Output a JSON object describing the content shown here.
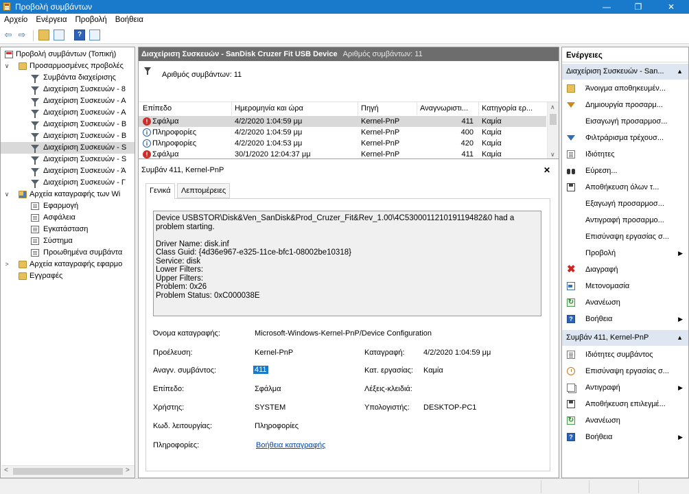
{
  "window": {
    "title": "Προβολή συμβάντων",
    "minimize": "—",
    "maximize": "❐",
    "close": "✕"
  },
  "menu": [
    "Αρχείο",
    "Ενέργεια",
    "Προβολή",
    "Βοήθεια"
  ],
  "toolbar": {
    "back": "⇦",
    "forward": "⇨",
    "help_glyph": "?"
  },
  "tree": {
    "items": [
      {
        "label": "Προβολή συμβάντων (Τοπική)",
        "icon": "event-viewer-icon",
        "level": 0,
        "twisty": ""
      },
      {
        "label": "Προσαρμοσμένες προβολές",
        "icon": "folder-icon",
        "level": 0,
        "twisty": "∨"
      },
      {
        "label": "Συμβάντα διαχείρισης",
        "icon": "filter-icon",
        "level": 1,
        "twisty": ""
      },
      {
        "label": "Διαχείριση Συσκευών - 8",
        "icon": "filter-icon",
        "level": 1,
        "twisty": ""
      },
      {
        "label": "Διαχείριση Συσκευών - Α",
        "icon": "filter-icon",
        "level": 1,
        "twisty": ""
      },
      {
        "label": "Διαχείριση Συσκευών - Α",
        "icon": "filter-icon",
        "level": 1,
        "twisty": ""
      },
      {
        "label": "Διαχείριση Συσκευών - Β",
        "icon": "filter-icon",
        "level": 1,
        "twisty": ""
      },
      {
        "label": "Διαχείριση Συσκευών - Β",
        "icon": "filter-icon",
        "level": 1,
        "twisty": ""
      },
      {
        "label": "Διαχείριση Συσκευών - S",
        "icon": "filter-icon",
        "level": 1,
        "twisty": "",
        "selected": true
      },
      {
        "label": "Διαχείριση Συσκευών - S",
        "icon": "filter-icon",
        "level": 1,
        "twisty": ""
      },
      {
        "label": "Διαχείριση Συσκευών - Ά",
        "icon": "filter-icon",
        "level": 1,
        "twisty": ""
      },
      {
        "label": "Διαχείριση Συσκευών - Γ",
        "icon": "filter-icon",
        "level": 1,
        "twisty": ""
      },
      {
        "label": "Αρχεία καταγραφής των Wi",
        "icon": "folder-icon",
        "level": 0,
        "twisty": "∨"
      },
      {
        "label": "Εφαρμογή",
        "icon": "log-icon",
        "level": 1,
        "twisty": ""
      },
      {
        "label": "Ασφάλεια",
        "icon": "log-icon",
        "level": 1,
        "twisty": ""
      },
      {
        "label": "Εγκατάσταση",
        "icon": "log-icon",
        "level": 1,
        "twisty": ""
      },
      {
        "label": "Σύστημα",
        "icon": "log-icon",
        "level": 1,
        "twisty": ""
      },
      {
        "label": "Προωθημένα συμβάντα",
        "icon": "log-icon",
        "level": 1,
        "twisty": ""
      },
      {
        "label": "Αρχεία καταγραφής εφαρμο",
        "icon": "folder-icon",
        "level": 0,
        "twisty": ">"
      },
      {
        "label": "Εγγραφές",
        "icon": "folder-icon",
        "level": 0,
        "twisty": ""
      }
    ],
    "scroll_left": "<",
    "scroll_right": ">"
  },
  "center": {
    "header_title": "Διαχείριση Συσκευών - SanDisk Cruzer Fit USB Device",
    "header_count": "Αριθμός συμβάντων: 11",
    "filter_text": "Αριθμός συμβάντων: 11",
    "columns": [
      "Επίπεδο",
      "Ημερομηνία και ώρα",
      "Πηγή",
      "Αναγνωριστι...",
      "Κατηγορία ερ..."
    ],
    "rows": [
      {
        "level": "Σφάλμα",
        "kind": "error",
        "datetime": "4/2/2020 1:04:59 μμ",
        "source": "Kernel-PnP",
        "id": "411",
        "category": "Καμία",
        "selected": true
      },
      {
        "level": "Πληροφορίες",
        "kind": "info",
        "datetime": "4/2/2020 1:04:59 μμ",
        "source": "Kernel-PnP",
        "id": "400",
        "category": "Καμία"
      },
      {
        "level": "Πληροφορίες",
        "kind": "info",
        "datetime": "4/2/2020 1:04:53 μμ",
        "source": "Kernel-PnP",
        "id": "420",
        "category": "Καμία"
      },
      {
        "level": "Σφάλμα",
        "kind": "error",
        "datetime": "30/1/2020 12:04:37 μμ",
        "source": "Kernel-PnP",
        "id": "411",
        "category": "Καμία"
      }
    ],
    "detail_title": "Συμβάν 411, Kernel-PnP",
    "detail_close": "✕",
    "tabs": [
      "Γενικά",
      "Λεπτομέρειες"
    ],
    "description": [
      "Device USBSTOR\\Disk&Ven_SanDisk&Prod_Cruzer_Fit&Rev_1.00\\4C530001121019119482&0 had a",
      "problem starting.",
      "",
      "Driver Name: disk.inf",
      "Class Guid: {4d36e967-e325-11ce-bfc1-08002be10318}",
      "Service: disk",
      "Lower Filters:",
      "Upper Filters:",
      "Problem: 0x26",
      "Problem Status: 0xC000038E"
    ],
    "props": {
      "log_name_label": "Όνομα καταγραφής:",
      "log_name_value": "Microsoft-Windows-Kernel-PnP/Device Configuration",
      "source_label": "Προέλευση:",
      "source_value": "Kernel-PnP",
      "logged_label": "Καταγραφή:",
      "logged_value": "4/2/2020 1:04:59 μμ",
      "event_id_label": "Αναγν. συμβάντος:",
      "event_id_value": "411",
      "task_label": "Κατ. εργασίας:",
      "task_value": "Καμία",
      "level_label": "Επίπεδο:",
      "level_value": "Σφάλμα",
      "keywords_label": "Λέξεις-κλειδιά:",
      "keywords_value": "",
      "user_label": "Χρήστης:",
      "user_value": "SYSTEM",
      "computer_label": "Υπολογιστής:",
      "computer_value": "DESKTOP-PC1",
      "opcode_label": "Κωδ. λειτουργίας:",
      "opcode_value": "Πληροφορίες",
      "info_label": "Πληροφορίες:",
      "info_link": "Βοήθεια καταγραφής"
    }
  },
  "actions": {
    "title": "Ενέργειες",
    "section1": "Διαχείριση Συσκευών - San...",
    "section1_items": [
      {
        "label": "Άνοιγμα αποθηκευμέν...",
        "icon": "open-folder-icon"
      },
      {
        "label": "Δημιουργία προσαρμ...",
        "icon": "create-view-icon"
      },
      {
        "label": "Εισαγωγή προσαρμοσ...",
        "icon": ""
      },
      {
        "label": "Φιλτράρισμα τρέχουσ...",
        "icon": "filter-icon"
      },
      {
        "label": "Ιδιότητες",
        "icon": "properties-icon"
      },
      {
        "label": "Εύρεση...",
        "icon": "binoculars-icon"
      },
      {
        "label": "Αποθήκευση όλων τ...",
        "icon": "save-icon"
      },
      {
        "label": "Εξαγωγή προσαρμοσ...",
        "icon": ""
      },
      {
        "label": "Αντιγραφή προσαρμο...",
        "icon": ""
      },
      {
        "label": "Επισύναψη εργασίας σ...",
        "icon": ""
      },
      {
        "label": "Προβολή",
        "icon": "",
        "submenu": true
      },
      {
        "label": "Διαγραφή",
        "icon": "delete-icon"
      },
      {
        "label": "Μετονομασία",
        "icon": "rename-icon"
      },
      {
        "label": "Ανανέωση",
        "icon": "refresh-icon"
      },
      {
        "label": "Βοήθεια",
        "icon": "help-icon",
        "submenu": true
      }
    ],
    "section2": "Συμβάν 411, Kernel-PnP",
    "section2_items": [
      {
        "label": "Ιδιότητες συμβάντος",
        "icon": "properties-icon"
      },
      {
        "label": "Επισύναψη εργασίας σ...",
        "icon": "task-icon"
      },
      {
        "label": "Αντιγραφή",
        "icon": "copy-icon",
        "submenu": true
      },
      {
        "label": "Αποθήκευση επιλεγμέ...",
        "icon": "save-icon"
      },
      {
        "label": "Ανανέωση",
        "icon": "refresh-icon"
      },
      {
        "label": "Βοήθεια",
        "icon": "help-icon",
        "submenu": true
      }
    ],
    "caret_up": "▲",
    "submenu_arrow": "▶"
  },
  "colors": {
    "titlebar": "#1979ca",
    "pane_header": "#6d6d6d",
    "section_header": "#dde6f1",
    "selection": "#d9d9d9",
    "error": "#c9302c",
    "link": "#0645ad"
  }
}
